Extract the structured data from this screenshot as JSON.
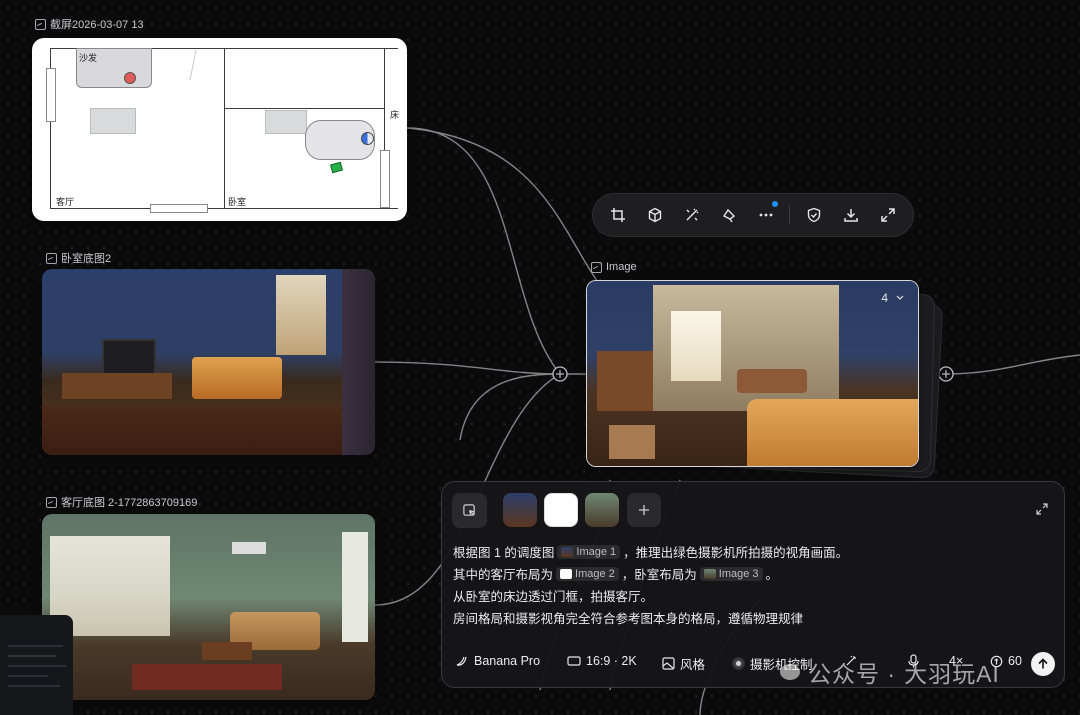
{
  "nodes": {
    "screenshot": {
      "label": "截屏2026-03-07 13"
    },
    "bedroom": {
      "label": "卧室底图2"
    },
    "living": {
      "label": "客厅底图 2-1772863709169"
    },
    "output": {
      "label": "Image",
      "count": "4"
    }
  },
  "floor_plan": {
    "sofa": "沙发",
    "living_room": "客厅",
    "bedroom": "卧室",
    "bed": "床"
  },
  "toolbar": {
    "items": [
      "crop-icon",
      "cube-icon",
      "magic-wand-icon",
      "brush-icon",
      "more-icon",
      "shield-icon",
      "download-icon",
      "expand-icon"
    ],
    "notification_color": "#1e90ff"
  },
  "prompt": {
    "line1": {
      "a": "根据图 1 的调度图",
      "chip": "Image 1",
      "b": "，推理出绿色摄影机所拍摄的视角画面。"
    },
    "line2": {
      "a": "其中的客厅布局为",
      "chip1": "Image 2",
      "b": "，卧室布局为",
      "chip2": "Image 3",
      "c": "。"
    },
    "line3": "从卧室的床边透过门框，拍摄客厅。",
    "line4": "房间格局和摄影视角完全符合参考图本身的格局，遵循物理规律"
  },
  "bottom_bar": {
    "model": "Banana Pro",
    "ratio": "16:9 · 2K",
    "style": "风格",
    "camera": "摄影机控制",
    "multiplier": "4×",
    "credits": "60"
  },
  "watermark": {
    "prefix": "公众号 ·",
    "name": "大羽玩AI"
  },
  "colors": {
    "accent_blue": "#1e90ff",
    "panel_bg": "#161618",
    "canvas_bg": "#0b0b0c"
  }
}
